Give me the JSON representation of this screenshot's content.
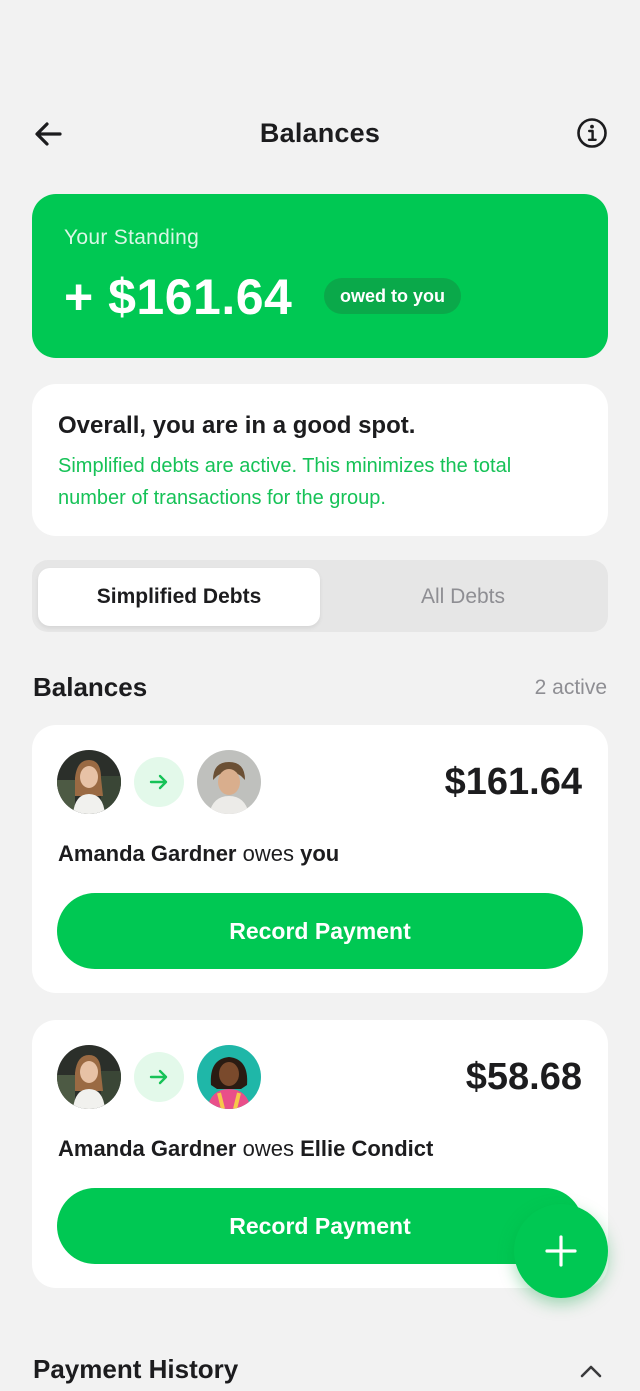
{
  "header": {
    "title": "Balances",
    "back_icon": "arrow-left-icon",
    "info_icon": "info-circle-icon"
  },
  "standing": {
    "label": "Your Standing",
    "amount": "+ $161.64",
    "badge": "owed to you",
    "color": "#00c853"
  },
  "status": {
    "title": "Overall, you are in a good spot.",
    "description": "Simplified debts are active. This minimizes the total number of transactions for the group."
  },
  "tabs": [
    {
      "label": "Simplified Debts",
      "active": true
    },
    {
      "label": "All Debts",
      "active": false
    }
  ],
  "balances": {
    "title": "Balances",
    "count": "2 active",
    "items": [
      {
        "from": "Amanda Gardner",
        "verb": "owes",
        "to": "you",
        "amount": "$161.64",
        "button": "Record Payment"
      },
      {
        "from": "Amanda Gardner",
        "verb": "owes",
        "to": "Ellie Condict",
        "amount": "$58.68",
        "button": "Record Payment"
      }
    ]
  },
  "payment_history": {
    "title": "Payment History",
    "toggle_icon": "chevron-up-icon"
  },
  "fab": {
    "icon": "plus-icon"
  },
  "colors": {
    "accent": "#00c853",
    "accent_text": "#16c257",
    "background": "#f2f2f2"
  }
}
